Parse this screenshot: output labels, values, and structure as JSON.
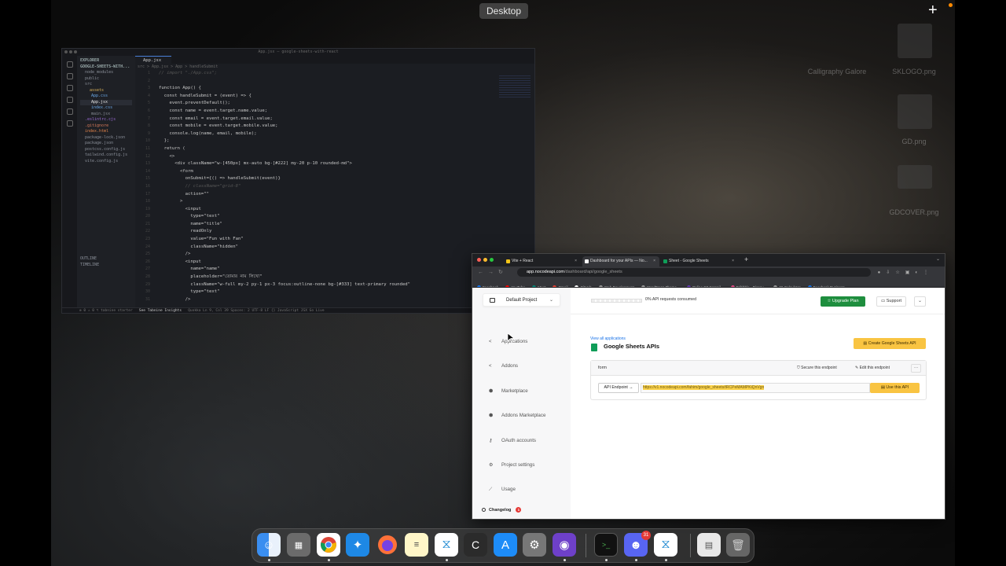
{
  "desktop": {
    "label": "Desktop",
    "files": [
      "Calligraphy Galore",
      "SKLOGO.png",
      "GD.png",
      "GDCOVER.png"
    ]
  },
  "vscode": {
    "window_title": "App.jsx — google-sheets-with-react",
    "explorer_label": "EXPLORER",
    "project_label": "GOOGLE-SHEETS-WITH...",
    "tree": [
      "node_modules",
      "public",
      "src",
      "assets",
      "App.css",
      "App.jsx",
      "index.css",
      "main.jsx",
      ".eslintrc.cjs",
      ".gitignore",
      "index.html",
      "package-lock.json",
      "package.json",
      "postcss.config.js",
      "tailwind.config.js",
      "vite.config.js"
    ],
    "outline": [
      "OUTLINE",
      "TIMELINE"
    ],
    "tab": "App.jsx",
    "breadcrumb": "src > App.jsx > App > handleSubmit",
    "code": [
      "// import \"./App.css\";",
      "",
      "function App() {",
      "  const handleSubmit = (event) => {",
      "    event.preventDefault();",
      "    const name = event.target.name.value;",
      "    const email = event.target.email.value;",
      "    const mobile = event.target.mobile.value;",
      "    console.log(name, email, mobile);",
      "  };",
      "  return (",
      "    <>",
      "      <div className=\"w-[450px] mx-auto bg-[#222] my-20 p-10 rounded-md\">",
      "        <form",
      "          onSubmit={() => handleSubmit(event)}",
      "          // className=\"grid-8\"",
      "          action=\"\"",
      "        >",
      "          <input",
      "            type=\"text\"",
      "            name=\"title\"",
      "            readOnly",
      "            value=\"Fun with Fan\"",
      "            className=\"hidden\"",
      "          />",
      "          <input",
      "            name=\"name\"",
      "            placeholder=\"তোমার নাম লিখো\"",
      "            className=\"w-full my-2 py-1 px-3 focus:outline-none bg-[#333] text-primary rounded\"",
      "            type=\"text\"",
      "          />"
    ],
    "status": {
      "left": "⊗ 0 ⚠ 0   ⌥ tabnine starter",
      "insight": "See Tabnine Insights",
      "right": "Quokka        Ln 9, Col 39   Spaces: 2   UTF-8   LF   {} JavaScript JSX   Go Live"
    }
  },
  "browser": {
    "tabs": [
      {
        "label": "Vite + React",
        "color": "#f5c518"
      },
      {
        "label": "Dashboard for your APIs — No...",
        "color": "#ffffff"
      },
      {
        "label": "Sheet - Google Sheets",
        "color": "#0f9d58"
      }
    ],
    "url_domain": "app.nocodeapi.com",
    "url_path": "/dashboard/api/google_sheets",
    "bookmarks": [
      {
        "label": "Facebook",
        "color": "#1877f2"
      },
      {
        "label": "YouTube",
        "color": "#ff0000"
      },
      {
        "label": "Meet",
        "color": "#00897b"
      },
      {
        "label": "Gmail",
        "color": "#ea4335"
      },
      {
        "label": "GitHub",
        "color": "#ffffff"
      },
      {
        "label": "Web-Development",
        "color": "#9e9e9e"
      },
      {
        "label": "WordPress Theme...",
        "color": "#9e9e9e"
      },
      {
        "label": "Online C# Compil...",
        "color": "#673ab7"
      },
      {
        "label": "Dribbble - Discov...",
        "color": "#ea4c89"
      },
      {
        "label": "JS-Calculator",
        "color": "#9e9e9e"
      },
      {
        "label": "Facebook Business...",
        "color": "#1877f2"
      }
    ]
  },
  "nocode": {
    "project": "Default Project",
    "nav": [
      {
        "label": "Applications",
        "icon": "share-icon"
      },
      {
        "label": "Addons",
        "icon": "share-icon"
      },
      {
        "label": "Marketplace",
        "icon": "cube-icon"
      },
      {
        "label": "Addons Marketplace",
        "icon": "cube-icon"
      },
      {
        "label": "OAuth accounts",
        "icon": "key-icon"
      },
      {
        "label": "Project settings",
        "icon": "gear-icon"
      },
      {
        "label": "Usage",
        "icon": "chart-icon"
      }
    ],
    "changelog": "Changelog",
    "changelog_count": "1",
    "usage": "0% API requests consumed",
    "usage_fraction": 0,
    "upgrade": "Upgrade Plan",
    "support": "Support",
    "view_all": "View all applications",
    "api_title": "Google Sheets APIs",
    "create_btn": "Create Google Sheets API",
    "card_name": "form",
    "secure": "Secure this endpoint",
    "edit": "Edit this endpoint",
    "endpoint_label": "API Endpoint →",
    "endpoint_url": "https://v1.nocodeapi.com/fahim/google_sheets/tRCPeMAMPKiQnVgn",
    "use_btn": "Use this API"
  },
  "dock": {
    "badge_discord": "31",
    "apps": [
      "Finder",
      "Launchpad",
      "Chrome",
      "Safari",
      "Firefox",
      "Notes",
      "VS Code",
      "CotEditor",
      "App Store",
      "System Settings",
      "GitHub Desktop",
      "Terminal",
      "Discord",
      "VS Code Insiders",
      "Preview",
      "Trash"
    ]
  }
}
